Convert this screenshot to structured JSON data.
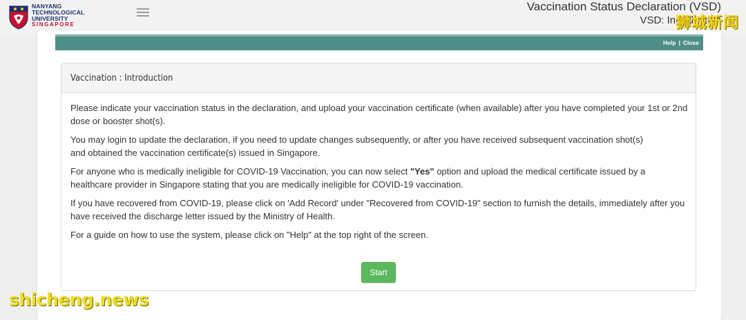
{
  "brand": {
    "logo_lines": [
      "NANYANG",
      "TECHNOLOGICAL",
      "UNIVERSITY"
    ],
    "logo_sub": "SINGAPORE",
    "primary_color": "#1d2f6f",
    "accent_color": "#c8102e"
  },
  "header": {
    "menu_icon": "hamburger-icon",
    "title": "Vaccination Status Declaration (VSD)",
    "subtitle": "VSD: Introduction"
  },
  "toolbar": {
    "help_label": "Help",
    "separator": "|",
    "close_label": "Close",
    "bar_color": "#4f8e86"
  },
  "card": {
    "title": "Vaccination : Introduction",
    "paragraphs": {
      "p1": "Please indicate your vaccination status in the declaration, and upload your vaccination certificate (when available) after you have completed your 1st or 2nd dose or booster shot(s).",
      "p2a": "You may login to update the declaration, if you need to update changes subsequently, or after you have received subsequent vaccination shot(s)",
      "p2b": "and obtained the vaccination certificate(s) issued in Singapore.",
      "p3_before": "For anyone who is medically ineligible for COVID-19 Vaccination, you can now select ",
      "p3_bold": "\"Yes\"",
      "p3_after": " option and upload the medical certificate issued by a healthcare provider in Singapore stating that you are medically ineligible for COVID-19 vaccination.",
      "p4": "If you have recovered from COVID-19, please click on 'Add Record' under \"Recovered from COVID-19\" section to furnish the details, immediately after you have received the discharge letter issued by the Ministry of Health.",
      "p5": "For a guide on how to use the system, please click on \"Help\" at the top right of the screen."
    },
    "start_label": "Start",
    "start_color": "#5cb85c"
  },
  "watermarks": {
    "cn": "狮城新闻",
    "en": "shicheng.news"
  }
}
